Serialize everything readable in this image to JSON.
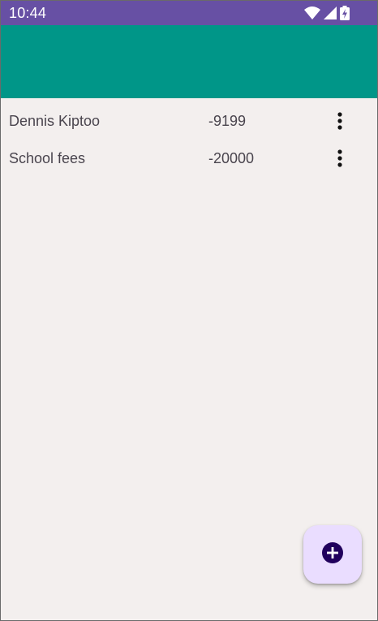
{
  "status_bar": {
    "time": "10:44",
    "icons": [
      "wifi-icon",
      "cellular-signal-icon",
      "battery-charging-icon"
    ],
    "color": "#6750a4"
  },
  "app_bar": {
    "color": "#009688"
  },
  "entries": [
    {
      "name": "Dennis Kiptoo",
      "amount": "-9199",
      "menu_icon": "more-vert-icon"
    },
    {
      "name": "School fees",
      "amount": "-20000",
      "menu_icon": "more-vert-icon"
    }
  ],
  "fab": {
    "icon": "add-circle-icon",
    "background": "#eaddff",
    "icon_color": "#21005d"
  }
}
